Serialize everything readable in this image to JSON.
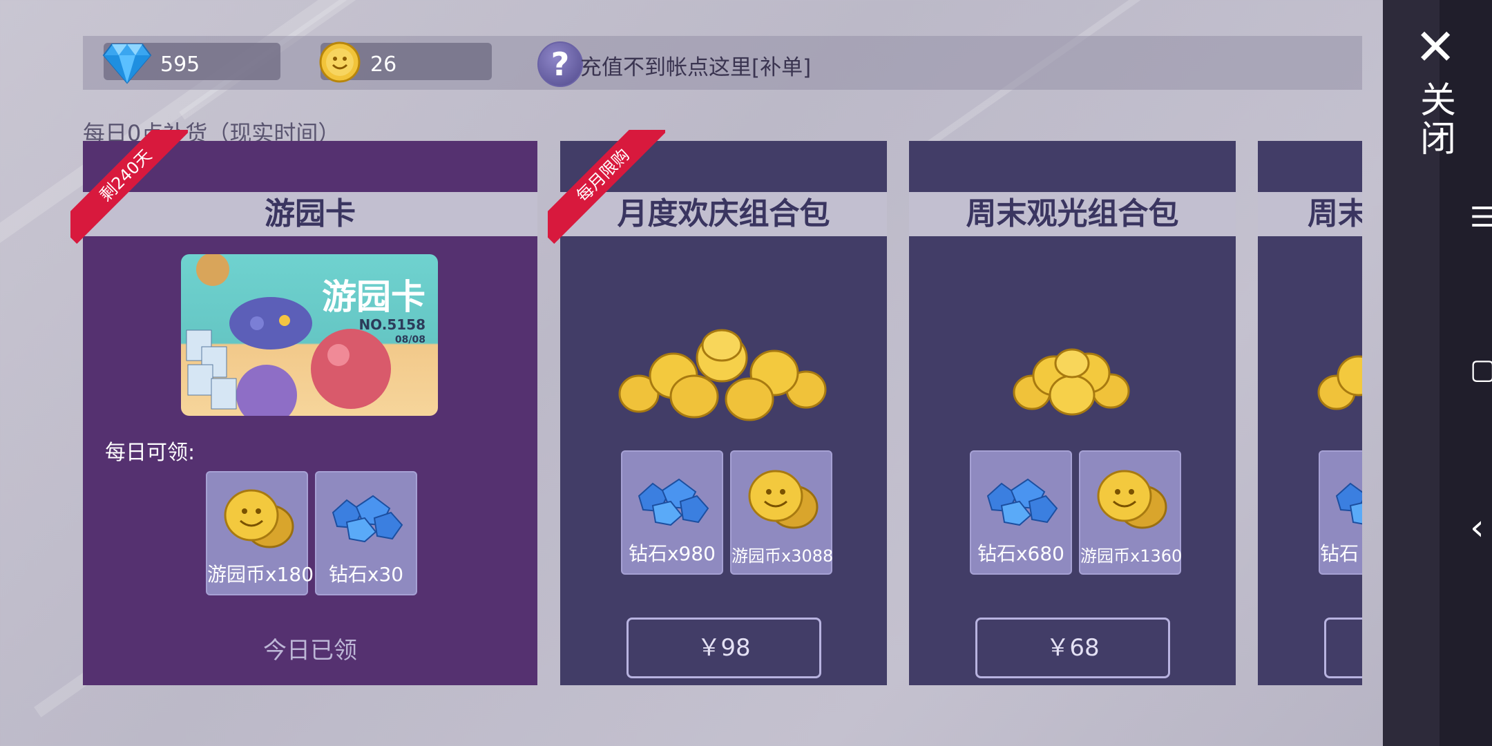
{
  "topbar": {
    "diamonds": "595",
    "coins": "26",
    "help": "?",
    "recharge_text": "充值不到帐点这里[补单]"
  },
  "restock_text": "每日0点补货（现实时间）",
  "cards": [
    {
      "title": "游园卡",
      "ribbon": "剩240天",
      "pass_title": "游园卡",
      "pass_no": "NO.5158",
      "pass_date": "08/08",
      "daily_label": "每日可领:",
      "items": [
        {
          "label": "游园币x180",
          "icon": "coin-pile-icon"
        },
        {
          "label": "钻石x30",
          "icon": "gem-cluster-icon"
        }
      ],
      "status": "今日已领"
    },
    {
      "title": "月度欢庆组合包",
      "ribbon": "每月限购",
      "items": [
        {
          "label": "钻石x980",
          "icon": "gem-cluster-icon"
        },
        {
          "label": "游园币x3088",
          "icon": "coin-pile-icon"
        }
      ],
      "price": "￥98"
    },
    {
      "title": "周末观光组合包",
      "items": [
        {
          "label": "钻石x680",
          "icon": "gem-cluster-icon"
        },
        {
          "label": "游园币x1360",
          "icon": "coin-pile-icon"
        }
      ],
      "price": "￥68"
    },
    {
      "title": "周末",
      "items": [
        {
          "label": "钻石",
          "icon": "gem-cluster-icon"
        }
      ]
    }
  ],
  "right_panel": {
    "close_icon": "✕",
    "close_label": "关闭",
    "menu_icon": "☰",
    "square_icon": "▢",
    "back_icon": "‹"
  },
  "colors": {
    "card_purple": "#553170",
    "card_navy": "#423d67",
    "ribbon_red": "#d8193d",
    "title_band": "#c2bfd0"
  }
}
